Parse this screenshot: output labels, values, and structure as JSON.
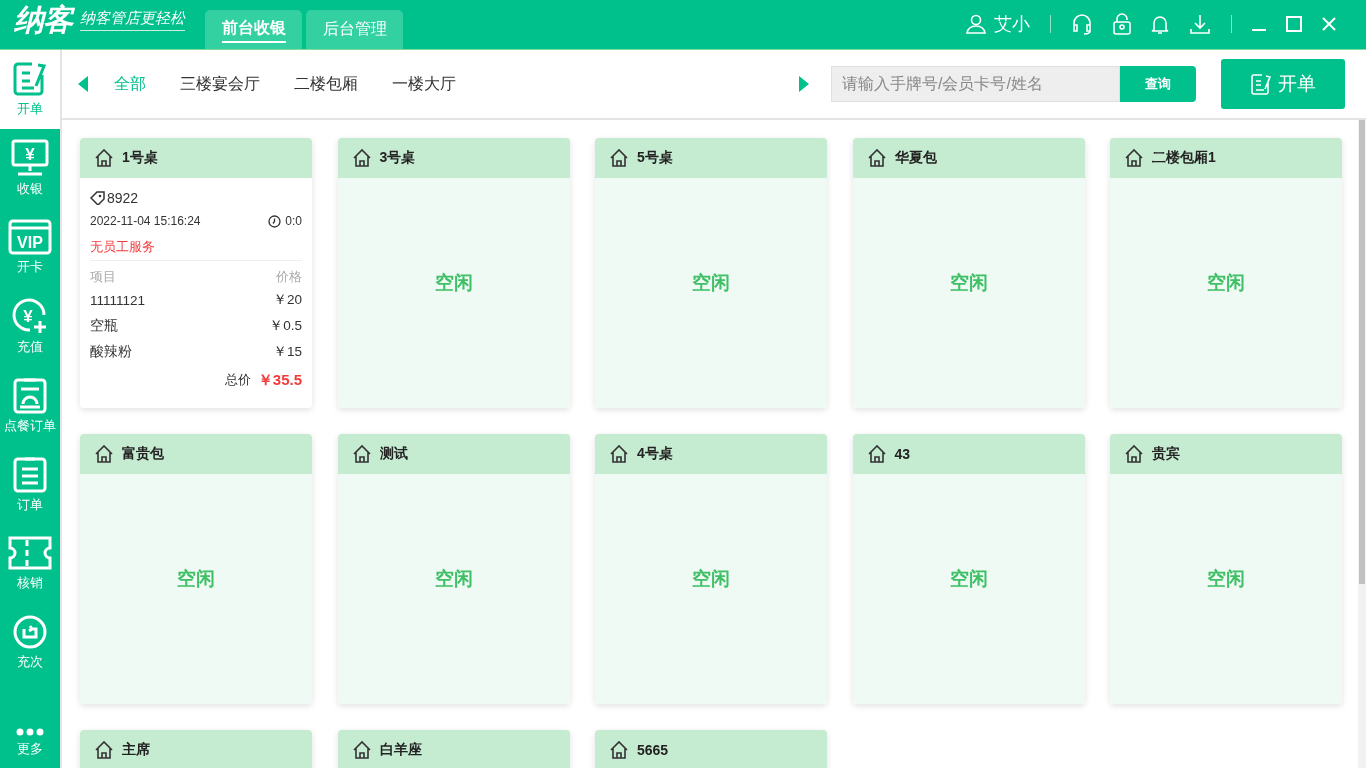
{
  "header": {
    "logo": "纳客",
    "slogan": "纳客管店更轻松",
    "tabs": [
      {
        "label": "前台收银",
        "selected": true
      },
      {
        "label": "后台管理",
        "selected": false
      }
    ],
    "user": "艾小"
  },
  "sidebar": {
    "items": [
      {
        "label": "开单",
        "selected": true
      },
      {
        "label": "收银",
        "selected": false,
        "icon_text": "¥"
      },
      {
        "label": "开卡",
        "selected": false,
        "icon_text": "VIP"
      },
      {
        "label": "充值",
        "selected": false,
        "icon_text": "¥"
      },
      {
        "label": "点餐订单",
        "selected": false
      },
      {
        "label": "订单",
        "selected": false
      },
      {
        "label": "核销",
        "selected": false
      },
      {
        "label": "充次",
        "selected": false
      },
      {
        "label": "更多",
        "selected": false
      }
    ]
  },
  "areas": [
    {
      "label": "全部",
      "selected": true
    },
    {
      "label": "三楼宴会厅",
      "selected": false
    },
    {
      "label": "二楼包厢",
      "selected": false
    },
    {
      "label": "一楼大厅",
      "selected": false
    }
  ],
  "search": {
    "placeholder": "请输入手牌号/会员卡号/姓名",
    "button": "查询"
  },
  "open_button": "开单",
  "tables": [
    {
      "name": "1号桌",
      "kind": "occupied",
      "tag": "8922",
      "time": "2022-11-04 15:16:24",
      "duration": "0:0",
      "note": "无员工服务",
      "col_item": "项目",
      "col_price": "价格",
      "items": [
        {
          "name": "11111121",
          "price": "￥20"
        },
        {
          "name": "空瓶",
          "price": "￥0.5"
        },
        {
          "name": "酸辣粉",
          "price": "￥15"
        }
      ],
      "total_label": "总价",
      "total": "￥35.5"
    },
    {
      "name": "3号桌",
      "kind": "idle",
      "status": "空闲"
    },
    {
      "name": "5号桌",
      "kind": "idle",
      "status": "空闲"
    },
    {
      "name": "华夏包",
      "kind": "idle",
      "status": "空闲"
    },
    {
      "name": "二楼包厢1",
      "kind": "idle",
      "status": "空闲"
    },
    {
      "name": "富贵包",
      "kind": "idle",
      "status": "空闲"
    },
    {
      "name": "测试",
      "kind": "idle",
      "status": "空闲"
    },
    {
      "name": "4号桌",
      "kind": "idle",
      "status": "空闲"
    },
    {
      "name": "43",
      "kind": "idle",
      "status": "空闲"
    },
    {
      "name": "贵宾",
      "kind": "idle",
      "status": "空闲"
    },
    {
      "name": "主席",
      "kind": "idle"
    },
    {
      "name": "白羊座",
      "kind": "idle"
    },
    {
      "name": "5665",
      "kind": "idle"
    }
  ]
}
